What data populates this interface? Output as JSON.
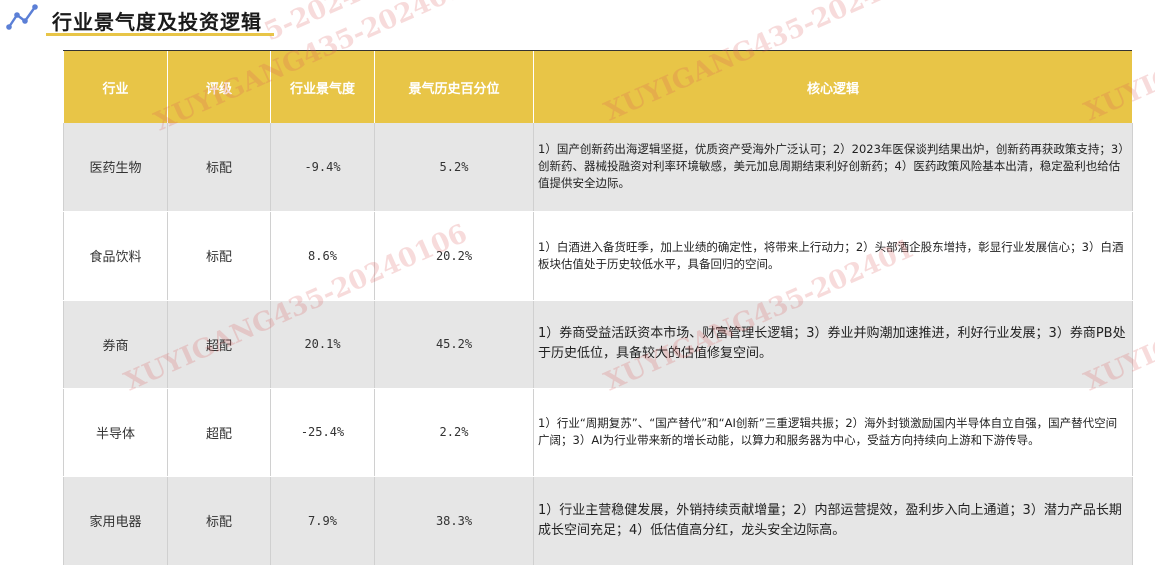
{
  "header": {
    "title": "行业景气度及投资逻辑",
    "accent_color": "#E8C547",
    "icon": "trend-line-icon"
  },
  "table": {
    "columns": [
      "行业",
      "评级",
      "行业景气度",
      "景气历史百分位",
      "核心逻辑"
    ],
    "header_color": "#E8C547",
    "rows": [
      {
        "industry": "医药生物",
        "rating": "标配",
        "prosperity": "-9.4%",
        "percentile": "5.2%",
        "logic": "1）国产创新药出海逻辑坚挺，优质资产受海外广泛认可；2）2023年医保谈判结果出炉，创新药再获政策支持；3）创新药、器械投融资对利率环境敏感，美元加息周期结束利好创新药；4）医药政策风险基本出清，稳定盈利也给估值提供安全边际。"
      },
      {
        "industry": "食品饮料",
        "rating": "标配",
        "prosperity": "8.6%",
        "percentile": "20.2%",
        "logic": "1）白酒进入备货旺季，加上业绩的确定性，将带来上行动力；2）头部酒企股东增持，彰显行业发展信心；3）白酒板块估值处于历史较低水平，具备回归的空间。"
      },
      {
        "industry": "券商",
        "rating": "超配",
        "prosperity": "20.1%",
        "percentile": "45.2%",
        "logic": "1）券商受益活跃资本市场、财富管理长逻辑；3）券业并购潮加速推进，利好行业发展；3）券商PB处于历史低位，具备较大的估值修复空间。"
      },
      {
        "industry": "半导体",
        "rating": "超配",
        "prosperity": "-25.4%",
        "percentile": "2.2%",
        "logic": "1）行业“周期复苏”、“国产替代”和“AI创新”三重逻辑共振；2）海外封锁激励国内半导体自立自强，国产替代空间广阔；3）AI为行业带来新的增长动能，以算力和服务器为中心，受益方向持续向上游和下游传导。"
      },
      {
        "industry": "家用电器",
        "rating": "标配",
        "prosperity": "7.9%",
        "percentile": "38.3%",
        "logic": "1）行业主营稳健发展，外销持续贡献增量；2）内部运营提效，盈利步入向上通道；3）潜力产品长期成长空间充足；4）低估值高分红，龙头安全边际高。"
      }
    ]
  },
  "watermark": {
    "text_a": "XUYIGANG435-20240106",
    "text_b": "XUYIGANG435-2024010",
    "text_c": "XUYIGANG435-202401",
    "text_d": "XUYIGANG435",
    "text_e": "5-20240106",
    "color": "#DC5A5A"
  }
}
